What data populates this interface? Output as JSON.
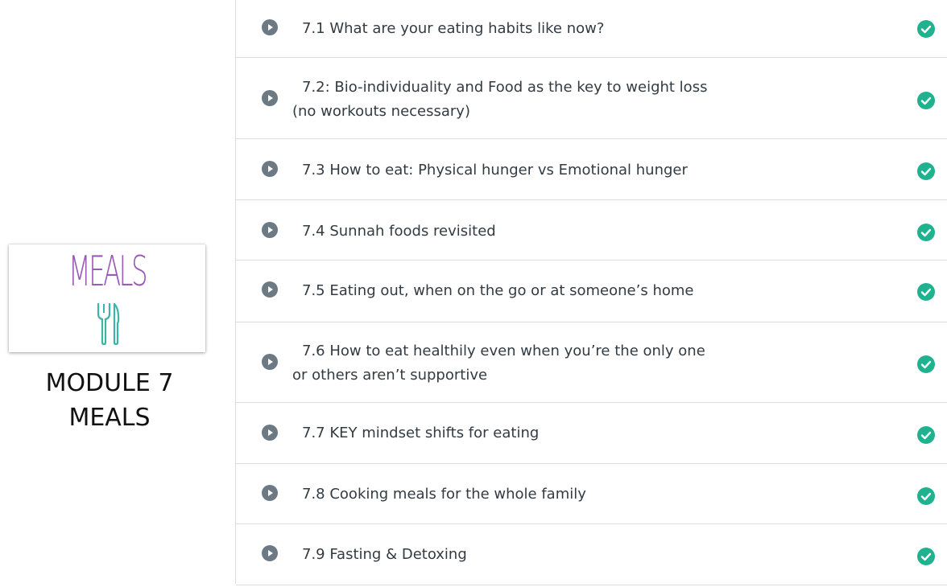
{
  "module": {
    "thumbnail_title": "MEALS",
    "caption_line1": "MODULE 7",
    "caption_line2": "MEALS"
  },
  "lessons": [
    {
      "label": "7.1 What are your eating habits like now?",
      "completed": true
    },
    {
      "label": "7.2: Bio-individuality and Food as the key to weight loss (no workouts necessary)",
      "completed": true
    },
    {
      "label": "7.3 How to eat: Physical hunger vs Emotional hunger",
      "completed": true
    },
    {
      "label": "7.4 Sunnah foods revisited",
      "completed": true
    },
    {
      "label": "7.5 Eating out, when on the go or at someone’s home",
      "completed": true
    },
    {
      "label": "7.6 How to eat healthily even when you’re the only one or others aren’t supportive",
      "completed": true
    },
    {
      "label": "7.7 KEY mindset shifts for eating",
      "completed": true
    },
    {
      "label": "7.8 Cooking meals for the whole family",
      "completed": true
    },
    {
      "label": "7.9 Fasting & Detoxing",
      "completed": true
    }
  ],
  "colors": {
    "title_purple": "#9a5bb5",
    "utensil_teal": "#3cb5a6",
    "check_green": "#1fb28f",
    "play_gray": "#6d7983"
  }
}
